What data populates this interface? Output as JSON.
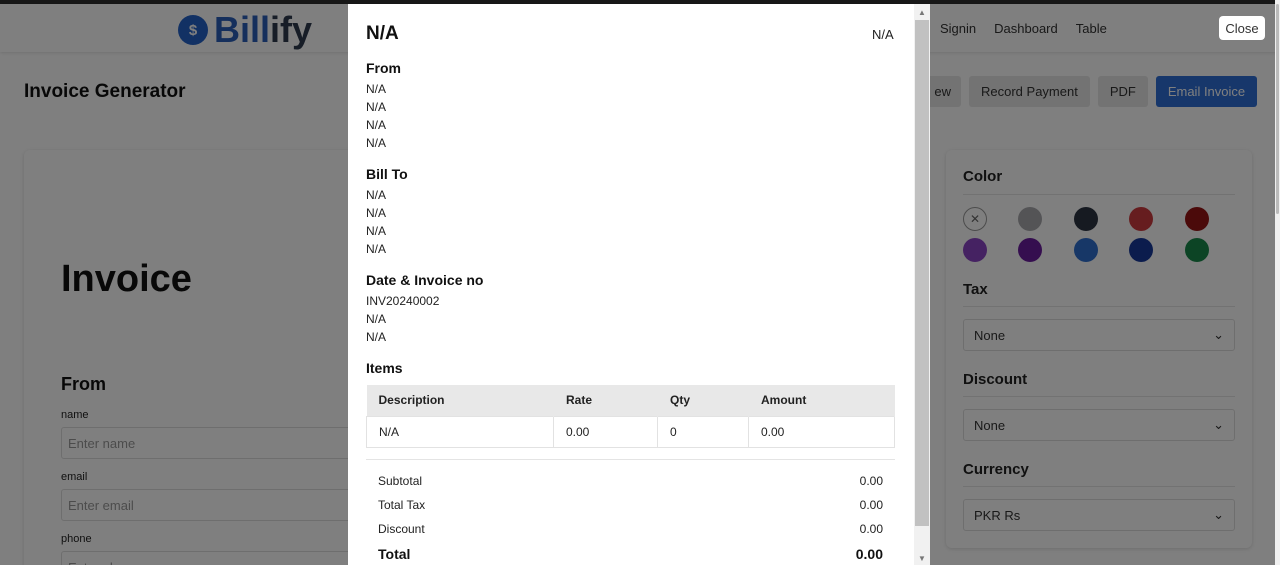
{
  "navbar": {
    "logo_icon": "$",
    "logo_part1": "Bill",
    "logo_part2": "ify",
    "links": [
      "Signin",
      "Dashboard",
      "Table"
    ]
  },
  "header": {
    "title": "Invoice Generator",
    "buttons": {
      "preview_partial": "ew",
      "record_payment": "Record Payment",
      "pdf": "PDF",
      "email_invoice": "Email Invoice"
    }
  },
  "form": {
    "invoice_heading": "Invoice",
    "from_heading": "From",
    "fields": [
      {
        "label": "name",
        "placeholder": "Enter name"
      },
      {
        "label": "email",
        "placeholder": "Enter email"
      },
      {
        "label": "phone",
        "placeholder": "Enter phone"
      }
    ]
  },
  "sidebar": {
    "color_heading": "Color",
    "colors": [
      "none",
      "#a8a8ad",
      "#2c3442",
      "#cc3a3e",
      "#961414",
      "#8a45c4",
      "#6a1c9e",
      "#2f6fce",
      "#17399b",
      "#18894a"
    ],
    "tax_heading": "Tax",
    "tax_value": "None",
    "discount_heading": "Discount",
    "discount_value": "None",
    "currency_heading": "Currency",
    "currency_value": "PKR Rs"
  },
  "modal": {
    "close_label": "Close",
    "title": "N/A",
    "title_right": "N/A",
    "from_heading": "From",
    "from_lines": [
      "N/A",
      "N/A",
      "N/A",
      "N/A"
    ],
    "billto_heading": "Bill To",
    "billto_lines": [
      "N/A",
      "N/A",
      "N/A",
      "N/A"
    ],
    "date_heading": "Date & Invoice no",
    "date_lines": [
      "INV20240002",
      "N/A",
      "N/A"
    ],
    "items_heading": "Items",
    "table": {
      "columns": [
        "Description",
        "Rate",
        "Qty",
        "Amount"
      ],
      "rows": [
        [
          "N/A",
          "0.00",
          "0",
          "0.00"
        ]
      ]
    },
    "summary": [
      {
        "label": "Subtotal",
        "value": "0.00"
      },
      {
        "label": "Total Tax",
        "value": "0.00"
      },
      {
        "label": "Discount",
        "value": "0.00"
      },
      {
        "label": "Total",
        "value": "0.00"
      }
    ]
  }
}
